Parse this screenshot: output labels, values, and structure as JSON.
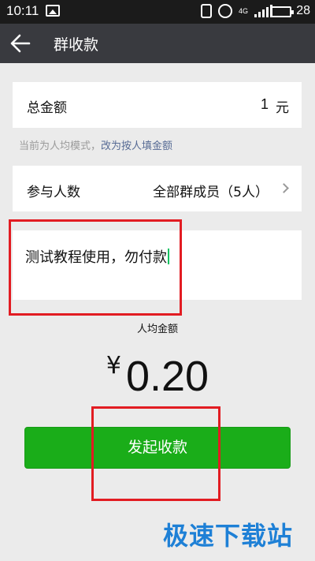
{
  "status_bar": {
    "time": "10:11",
    "network": "4G",
    "battery": "28"
  },
  "header": {
    "title": "群收款"
  },
  "total": {
    "label": "总金额",
    "amount": "1",
    "unit": "元"
  },
  "mode_hint": {
    "text": "当前为人均模式，",
    "link": "改为按人填金额"
  },
  "participants": {
    "label": "参与人数",
    "value": "全部群成员（5人）"
  },
  "memo": {
    "value": "测试教程使用，勿付款"
  },
  "per_person": {
    "label": "人均金额",
    "currency": "¥",
    "amount": "0.20"
  },
  "submit": {
    "label": "发起收款"
  },
  "watermark": "极速下载站",
  "colors": {
    "accent": "#1aad19",
    "link": "#576b95",
    "annotation": "#e21c22",
    "watermark": "#1e80d6"
  }
}
